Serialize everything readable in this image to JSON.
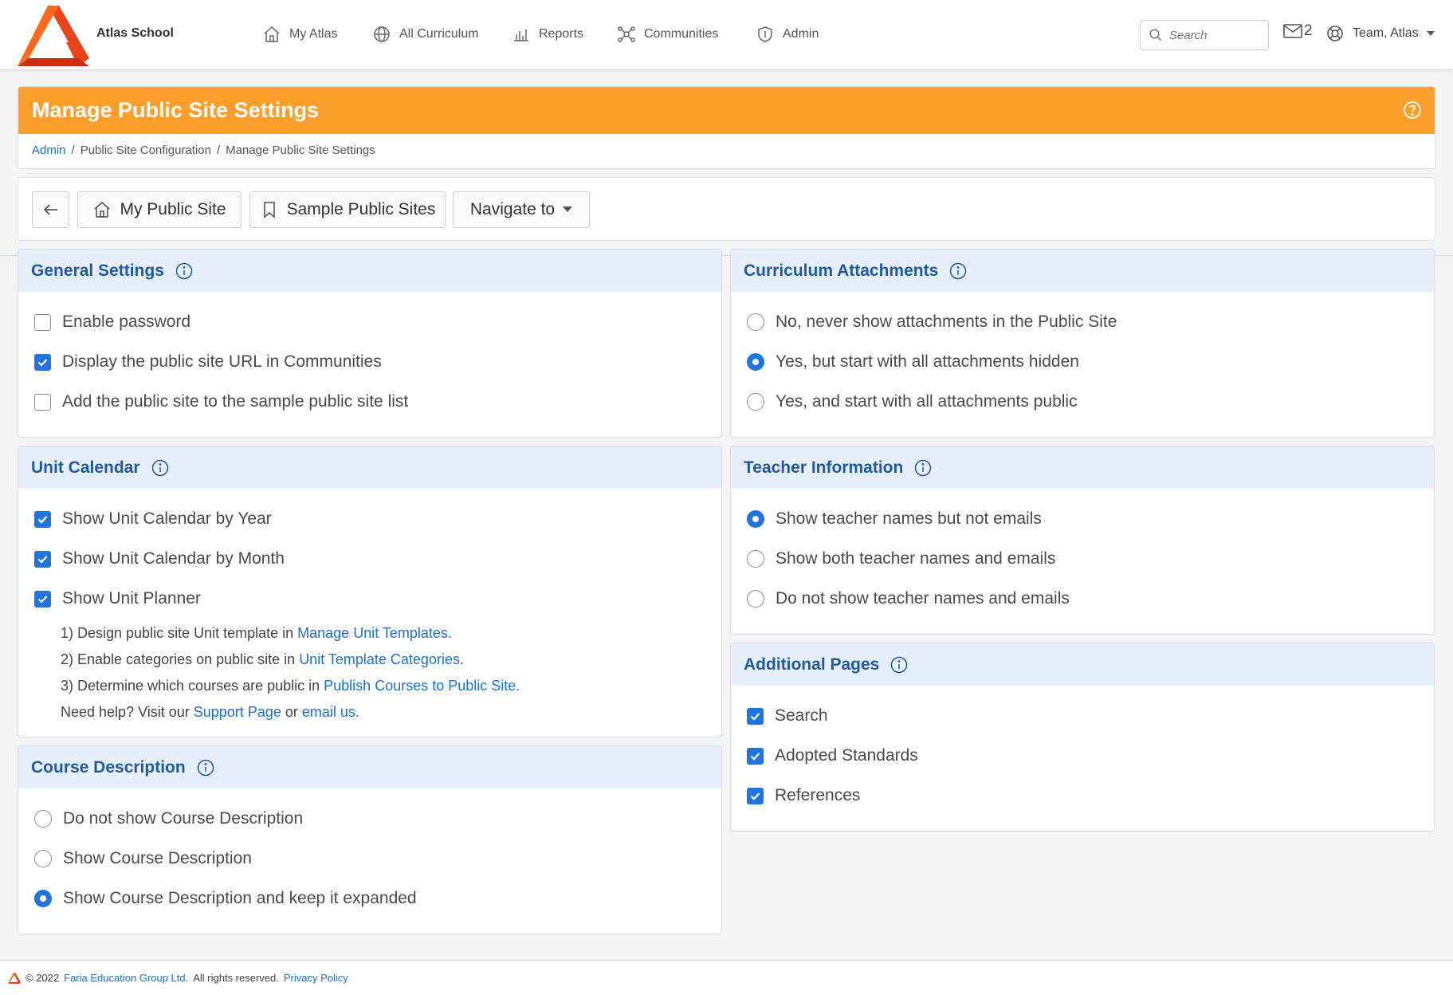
{
  "app": {
    "school_name": "Atlas School",
    "nav": [
      {
        "label": "My Atlas",
        "icon": "home-icon"
      },
      {
        "label": "All Curriculum",
        "icon": "globe-icon"
      },
      {
        "label": "Reports",
        "icon": "bar-chart-icon"
      },
      {
        "label": "Communities",
        "icon": "network-icon"
      },
      {
        "label": "Admin",
        "icon": "shield-icon"
      }
    ],
    "search_placeholder": "Search",
    "mail_count": "2",
    "user_name": "Team, Atlas"
  },
  "page": {
    "title": "Manage Public Site Settings",
    "breadcrumbs": [
      "Admin",
      "Public Site Configuration",
      "Manage Public Site Settings"
    ],
    "breadcrumb_sep": "/"
  },
  "toolbar": {
    "my_public_site": "My Public Site",
    "sample_public_sites": "Sample Public Sites",
    "navigate_to": "Navigate to"
  },
  "general_settings": {
    "title": "General Settings",
    "options": [
      {
        "label": "Enable password",
        "checked": false
      },
      {
        "label": "Display the public site URL in Communities",
        "checked": true
      },
      {
        "label": "Add the public site to the sample public site list",
        "checked": false
      }
    ]
  },
  "unit_calendar": {
    "title": "Unit Calendar",
    "options": [
      {
        "label": "Show Unit Calendar by Year",
        "checked": true
      },
      {
        "label": "Show Unit Calendar by Month",
        "checked": true
      },
      {
        "label": "Show Unit Planner",
        "checked": true
      }
    ],
    "notes": [
      {
        "text": "1) Design public site Unit template in ",
        "link": "Manage Unit Templates."
      },
      {
        "text": "2) Enable categories on public site in ",
        "link": "Unit Template Categories."
      },
      {
        "text": "3) Determine which courses are public in ",
        "link": "Publish Courses to Public Site."
      }
    ],
    "help_prefix": "Need help? Visit our ",
    "help_link1": "Support Page",
    "help_mid": " or ",
    "help_link2": "email us."
  },
  "course_description": {
    "title": "Course Description",
    "options": [
      {
        "label": "Do not show Course Description",
        "selected": false
      },
      {
        "label": "Show Course Description",
        "selected": false
      },
      {
        "label": "Show Course Description and keep it expanded",
        "selected": true
      }
    ]
  },
  "curriculum_attachments": {
    "title": "Curriculum Attachments",
    "options": [
      {
        "label": "No, never show attachments in the Public Site",
        "selected": false
      },
      {
        "label": "Yes, but start with all attachments hidden",
        "selected": true
      },
      {
        "label": "Yes, and start with all attachments public",
        "selected": false
      }
    ]
  },
  "teacher_information": {
    "title": "Teacher Information",
    "options": [
      {
        "label": "Show teacher names but not emails",
        "selected": true
      },
      {
        "label": "Show both teacher names and emails",
        "selected": false
      },
      {
        "label": "Do not show teacher names and emails",
        "selected": false
      }
    ]
  },
  "additional_pages": {
    "title": "Additional Pages",
    "options": [
      {
        "label": "Search",
        "checked": true
      },
      {
        "label": "Adopted Standards",
        "checked": true
      },
      {
        "label": "References",
        "checked": true
      }
    ]
  },
  "footer": {
    "copyright": "© 2022",
    "company": "Faria Education Group Ltd.",
    "rights": "All rights reserved.",
    "privacy": "Privacy Policy"
  },
  "colors": {
    "accent_orange": "#fd9e2a",
    "header_blue": "#1e5aa8",
    "link_blue": "#1a6fd0",
    "check_blue": "#1f74e0",
    "section_bg": "#e6effb"
  }
}
